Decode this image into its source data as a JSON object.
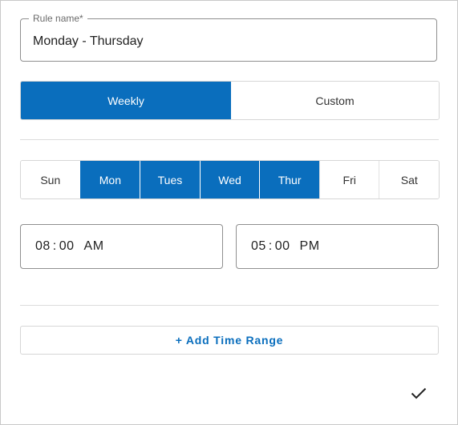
{
  "rule_name": {
    "label": "Rule name*",
    "value": "Monday - Thursday"
  },
  "mode_toggle": {
    "options": [
      "Weekly",
      "Custom"
    ],
    "selected": "Weekly"
  },
  "days": {
    "labels": [
      "Sun",
      "Mon",
      "Tues",
      "Wed",
      "Thur",
      "Fri",
      "Sat"
    ],
    "selected": [
      "Mon",
      "Tues",
      "Wed",
      "Thur"
    ]
  },
  "time_range": {
    "start": {
      "hour": "08",
      "minute": "00",
      "period": "AM"
    },
    "end": {
      "hour": "05",
      "minute": "00",
      "period": "PM"
    }
  },
  "add_range_label": "+ Add Time Range",
  "icons": {
    "confirm": "checkmark-icon"
  },
  "colors": {
    "accent": "#0a6ebd"
  }
}
